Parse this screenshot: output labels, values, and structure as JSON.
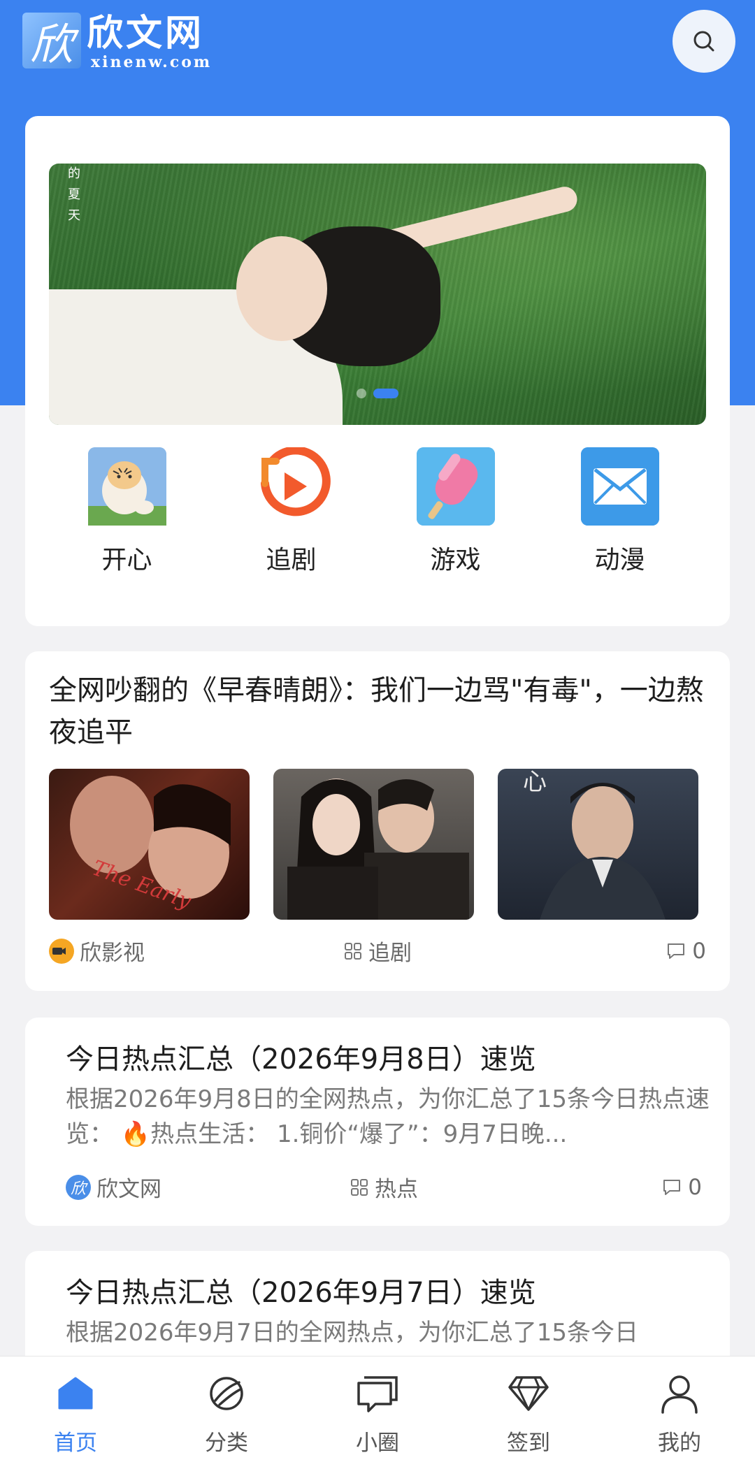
{
  "header": {
    "logo_mark": "欣",
    "logo_cn": "欣文网",
    "logo_en": "xinenw.com",
    "search_icon": "search-icon"
  },
  "banner": {
    "vertical_text": [
      "的",
      "夏",
      "天"
    ],
    "active_slide": 2,
    "slide_count": 2
  },
  "quick_links": [
    {
      "label": "开心",
      "icon": "tiger-icon"
    },
    {
      "label": "追剧",
      "icon": "play-icon"
    },
    {
      "label": "游戏",
      "icon": "popsicle-icon"
    },
    {
      "label": "动漫",
      "icon": "mail-icon"
    }
  ],
  "article": {
    "title": "全网吵翻的《早春晴朗》：我们一边骂\"有毒\"，一边熬夜追平",
    "source": "欣影视",
    "category": "追剧",
    "comments": "0"
  },
  "news": [
    {
      "title": "今日热点汇总（2026年9月8日）速览",
      "summary": "根据2026年9月8日的全网热点，为你汇总了15条今日热点速览： 🔥热点生活： 1.铜价“爆了”：9月7日晚...",
      "source": "欣文网",
      "category": "热点",
      "comments": "0"
    },
    {
      "title": "今日热点汇总（2026年9月7日）速览",
      "summary": "根据2026年9月7日的全网热点，为你汇总了15条今日"
    }
  ],
  "bottom_nav": [
    {
      "label": "首页",
      "icon": "home-icon",
      "active": true
    },
    {
      "label": "分类",
      "icon": "planet-icon",
      "active": false
    },
    {
      "label": "小圈",
      "icon": "chat-icon",
      "active": false
    },
    {
      "label": "签到",
      "icon": "diamond-icon",
      "active": false
    },
    {
      "label": "我的",
      "icon": "user-icon",
      "active": false
    }
  ],
  "colors": {
    "accent": "#3b82f0",
    "background": "#f2f2f4"
  }
}
